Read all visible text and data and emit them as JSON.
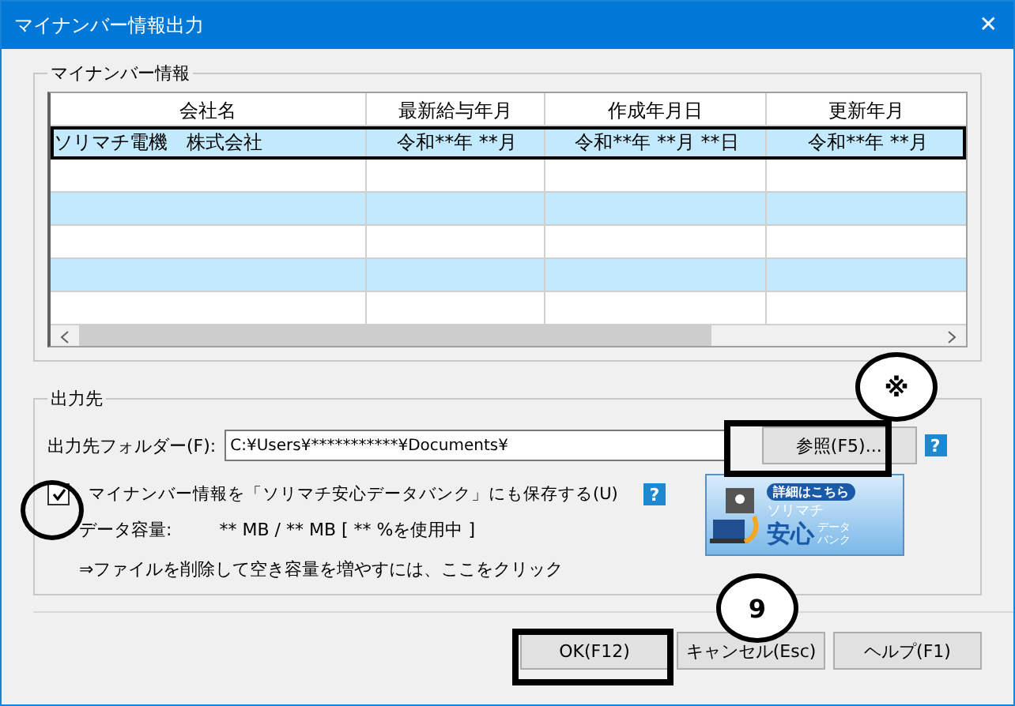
{
  "window": {
    "title": "マイナンバー情報出力",
    "close": "✕"
  },
  "info_group": {
    "label": "マイナンバー情報",
    "columns": [
      "会社名",
      "最新給与年月",
      "作成年月日",
      "更新年月"
    ],
    "rows": [
      {
        "cells": [
          "ソリマチ電機　株式会社",
          "令和**年 **月",
          "令和**年 **月 **日",
          "令和**年 **月"
        ],
        "selected": true
      }
    ]
  },
  "output_group": {
    "label": "出力先",
    "folder_label": "出力先フォルダー(F):",
    "folder_value": "C:¥Users¥***********¥Documents¥",
    "browse_button": "参照(F5)...",
    "help_glyph": "?",
    "save_option": {
      "label": "マイナンバー情報を「ソリマチ安心データバンク」にも保存する(U)",
      "checked": true
    },
    "capacity_label": "データ容量:",
    "capacity_value": "** MB /  ** MB [ ** %を使用中 ]",
    "cleanup_link": "⇒ファイルを削除して空き容量を増やすには、ここをクリック",
    "banner": {
      "top": "詳細はこちら",
      "brand": "ソリマチ",
      "big": "安心",
      "small1": "データ",
      "small2": "バンク"
    }
  },
  "buttons": [
    "OK(F12)",
    "キャンセル(Esc)",
    "ヘルプ(F1)"
  ],
  "annotations": [
    "※",
    "9"
  ]
}
